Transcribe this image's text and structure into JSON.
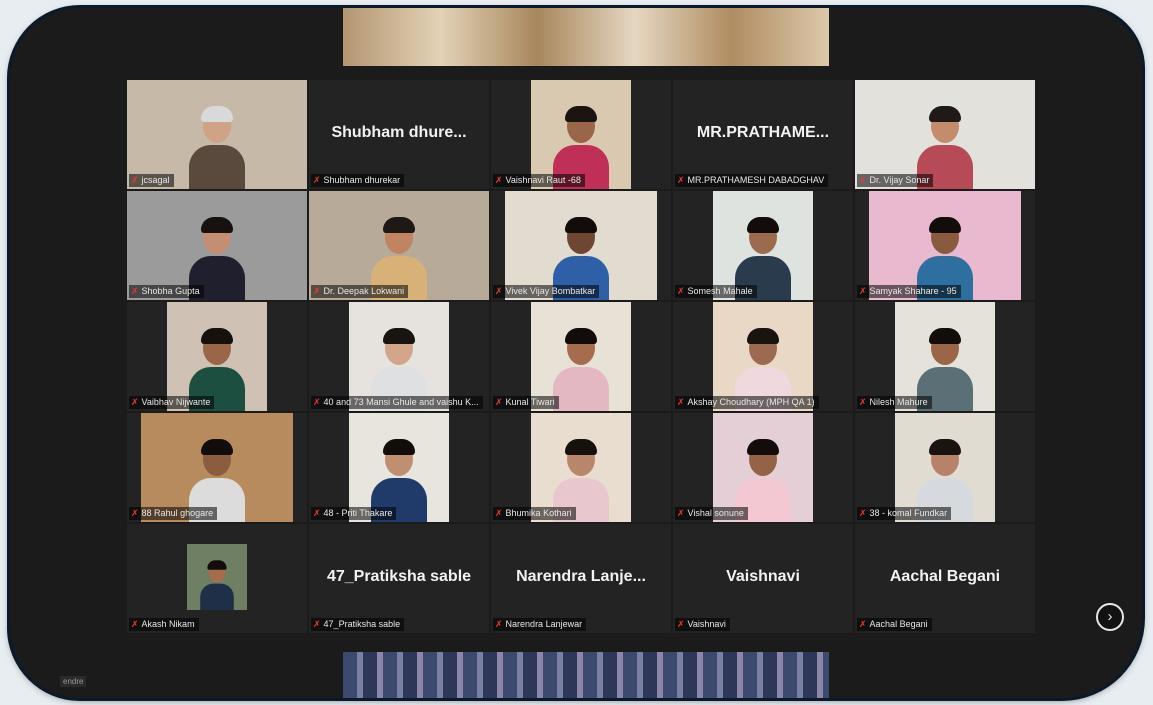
{
  "participants": [
    {
      "label": "jcsagal",
      "big": "",
      "video": "full",
      "bg": "#c7b9a8",
      "skin": "#d0a288",
      "hair": "#d9d9d9",
      "shirt": "#5a4a3e"
    },
    {
      "label": "Shubham dhurekar",
      "big": "Shubham  dhure...",
      "video": "none"
    },
    {
      "label": "Vaishnavi Raut -68",
      "big": "",
      "video": "mid",
      "bg": "#d8c9b0",
      "skin": "#9a6548",
      "hair": "#1b1410",
      "shirt": "#c02f55"
    },
    {
      "label": "MR.PRATHAMESH DABADGHAV",
      "big": "MR.PRATHAME...",
      "video": "none"
    },
    {
      "label": "Dr. Vijay Sonar",
      "big": "",
      "video": "full",
      "bg": "#e3e1dc",
      "skin": "#c38c6c",
      "hair": "#1f1a17",
      "shirt": "#b64a56"
    },
    {
      "label": "Shobha Gupta",
      "big": "",
      "video": "full",
      "bg": "#9b9b9b",
      "skin": "#c48e74",
      "hair": "#17120f",
      "shirt": "#1f1f2d"
    },
    {
      "label": "Dr. Deepak Lokwani",
      "big": "",
      "video": "full",
      "bg": "#b8aa98",
      "skin": "#c08462",
      "hair": "#1e1915",
      "shirt": "#d8b178"
    },
    {
      "label": "Vivek Vijay Bombatkar",
      "big": "",
      "video": "wide",
      "bg": "#e2dcd0",
      "skin": "#6e4632",
      "hair": "#120d0a",
      "shirt": "#2f5fa6"
    },
    {
      "label": "Somesh Mahale",
      "big": "",
      "video": "mid",
      "bg": "#dfe3e0",
      "skin": "#9c6a4c",
      "hair": "#120d0a",
      "shirt": "#2a3b4d"
    },
    {
      "label": "Samyak Shahare - 95",
      "big": "",
      "video": "wide",
      "bg": "#e8b9cf",
      "skin": "#8a5a3e",
      "hair": "#120d0a",
      "shirt": "#2f6fa0"
    },
    {
      "label": "Vaibhav Nijwante",
      "big": "",
      "video": "mid",
      "bg": "#cfc2b4",
      "skin": "#9a6548",
      "hair": "#16110d",
      "shirt": "#1d4f40"
    },
    {
      "label": "40 and 73 Mansi Ghule and vaishu K...",
      "big": "",
      "video": "mid",
      "bg": "#e6e3df",
      "skin": "#d3a58a",
      "hair": "#1a1410",
      "shirt": "#dfe0e2"
    },
    {
      "label": "Kunal Tiwari",
      "big": "",
      "video": "mid",
      "bg": "#e8e2d6",
      "skin": "#a56c4d",
      "hair": "#120d0a",
      "shirt": "#e4b8c2"
    },
    {
      "label": "Akshay Choudhary (MPH QA 1)",
      "big": "",
      "video": "mid",
      "bg": "#e9d8c6",
      "skin": "#9b6a50",
      "hair": "#1a1410",
      "shirt": "#efd9df"
    },
    {
      "label": "Nilesh Mahure",
      "big": "",
      "video": "mid",
      "bg": "#e5e2dc",
      "skin": "#9a6548",
      "hair": "#120d0a",
      "shirt": "#5b6f77"
    },
    {
      "label": "88 Rahul ghogare",
      "big": "",
      "video": "wide",
      "bg": "#b88b5e",
      "skin": "#8a5c40",
      "hair": "#120d0a",
      "shirt": "#dcdcdc"
    },
    {
      "label": "48 - Priti Thakare",
      "big": "",
      "video": "mid",
      "bg": "#e8e4de",
      "skin": "#c08f72",
      "hair": "#120d0a",
      "shirt": "#203a6a"
    },
    {
      "label": "Bhumika Kothari",
      "big": "",
      "video": "mid",
      "bg": "#e8ddce",
      "skin": "#b8876b",
      "hair": "#16110d",
      "shirt": "#e9c7cf"
    },
    {
      "label": "Vishal sonune",
      "big": "",
      "video": "mid",
      "bg": "#e5cfd6",
      "skin": "#946247",
      "hair": "#120d0a",
      "shirt": "#f3c8d3"
    },
    {
      "label": "38 - komal Fundkar",
      "big": "",
      "video": "mid",
      "bg": "#e1dcd2",
      "skin": "#b8826a",
      "hair": "#1a1410",
      "shirt": "#d6dade"
    },
    {
      "label": "Akash Nikam",
      "big": "",
      "video": "small",
      "bg": "#6f7f63",
      "skin": "#a46d4d",
      "hair": "#120d0a",
      "shirt": "#1f2f48"
    },
    {
      "label": "47_Pratiksha sable",
      "big": "47_Pratiksha sable",
      "video": "none"
    },
    {
      "label": "Narendra Lanjewar",
      "big": "Narendra  Lanje...",
      "video": "none"
    },
    {
      "label": "Vaishnavi",
      "big": "Vaishnavi",
      "video": "none"
    },
    {
      "label": "Aachal Begani",
      "big": "Aachal Begani",
      "video": "none"
    }
  ],
  "next_button": "›",
  "corner_label": "endre",
  "colors": {
    "frame": "#1b1b1b",
    "tile": "#232323",
    "mic_muted": "#e53935"
  }
}
